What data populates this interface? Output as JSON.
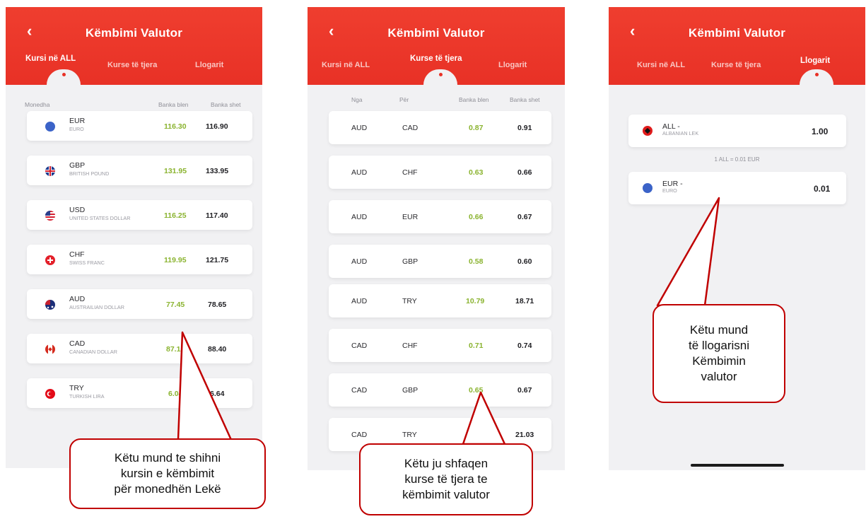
{
  "app": {
    "title": "Këmbimi Valutor",
    "back_icon": "chevron-left-icon",
    "tabs": [
      "Kursi në ALL",
      "Kurse të tjera",
      "Llogarit"
    ],
    "accent": "#e83126",
    "buy_color": "#8ab32f"
  },
  "screen1": {
    "headers": {
      "currency": "Monedha",
      "buy": "Banka blen",
      "sell": "Banka shet"
    },
    "rows": [
      {
        "code": "EUR",
        "name": "EURO",
        "buy": "116.30",
        "sell": "116.90",
        "flag": "eu-flag-icon"
      },
      {
        "code": "GBP",
        "name": "BRITISH POUND",
        "buy": "131.95",
        "sell": "133.95",
        "flag": "uk-flag-icon"
      },
      {
        "code": "USD",
        "name": "UNITED STATES DOLLAR",
        "buy": "116.25",
        "sell": "117.40",
        "flag": "us-flag-icon"
      },
      {
        "code": "CHF",
        "name": "SWISS FRANC",
        "buy": "119.95",
        "sell": "121.75",
        "flag": "swiss-flag-icon"
      },
      {
        "code": "AUD",
        "name": "AUSTRAILIAN DOLLAR",
        "buy": "77.45",
        "sell": "78.65",
        "flag": "australia-flag-icon"
      },
      {
        "code": "CAD",
        "name": "CANADIAN DOLLAR",
        "buy": "87.15",
        "sell": "88.40",
        "flag": "canada-flag-icon"
      },
      {
        "code": "TRY",
        "name": "TURKISH LIRA",
        "buy": "6.04",
        "sell": "6.64",
        "flag": "turkey-flag-icon"
      }
    ]
  },
  "screen2": {
    "headers": {
      "from": "Nga",
      "to": "Për",
      "buy": "Banka blen",
      "sell": "Banka shet"
    },
    "rows": [
      {
        "from": "AUD",
        "to": "CAD",
        "buy": "0.87",
        "sell": "0.91"
      },
      {
        "from": "AUD",
        "to": "CHF",
        "buy": "0.63",
        "sell": "0.66"
      },
      {
        "from": "AUD",
        "to": "EUR",
        "buy": "0.66",
        "sell": "0.67"
      },
      {
        "from": "AUD",
        "to": "GBP",
        "buy": "0.58",
        "sell": "0.60"
      },
      {
        "from": "AUD",
        "to": "TRY",
        "buy": "10.79",
        "sell": "18.71"
      },
      {
        "from": "CAD",
        "to": "CHF",
        "buy": "0.71",
        "sell": "0.74"
      },
      {
        "from": "CAD",
        "to": "GBP",
        "buy": "0.65",
        "sell": "0.67"
      },
      {
        "from": "CAD",
        "to": "TRY",
        "buy": "",
        "sell": "21.03"
      }
    ]
  },
  "screen3": {
    "from": {
      "code": "ALL",
      "name": "ALBANIAN LEK",
      "amount": "1.00",
      "flag": "albania-flag-icon"
    },
    "rate_note": "1 ALL = 0.01 EUR",
    "to": {
      "code": "EUR",
      "name": "EURO",
      "amount": "0.01",
      "flag": "eu-flag-icon"
    },
    "dash": "-"
  },
  "callouts": {
    "c1": [
      "Këtu mund te shihni",
      "kursin e këmbimit",
      "për monedhën Lekë"
    ],
    "c2": [
      "Këtu ju shfaqen",
      "kurse të tjera te",
      "këmbimit valutor"
    ],
    "c3": [
      "Këtu mund",
      "të llogarisni",
      "Këmbimin",
      "valutor"
    ]
  }
}
